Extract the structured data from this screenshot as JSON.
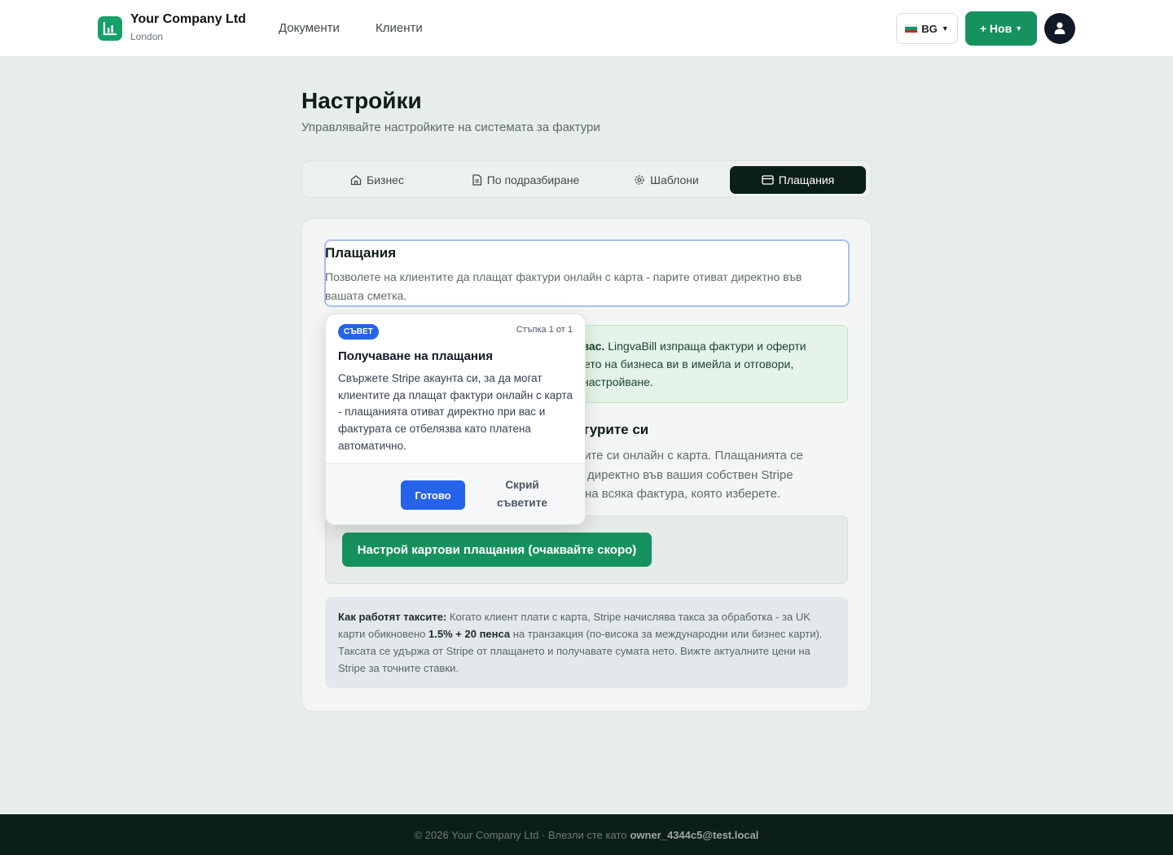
{
  "header": {
    "company_name": "Your Company Ltd",
    "company_city": "London",
    "nav": [
      "Документи",
      "Клиенти"
    ],
    "lang_label": "BG",
    "new_label": "+ Нов",
    "brand_color": "#16925f"
  },
  "page": {
    "title": "Настройки",
    "subtitle": "Управлявайте настройките на системата за фактури"
  },
  "tabs": [
    {
      "label": "Бизнес",
      "icon": "home-icon",
      "active": false
    },
    {
      "label": "По подразбиране",
      "icon": "document-icon",
      "active": false
    },
    {
      "label": "Шаблони",
      "icon": "gear-icon",
      "active": false
    },
    {
      "label": "Плащания",
      "icon": "credit-card-icon",
      "active": true
    }
  ],
  "payments": {
    "title": "Плащания",
    "description": "Позволете на клиентите да плащат фактури онлайн с карта - парите отиват директно във вашата сметка.",
    "green_bold": "о вас.",
    "green_text_1": "LingvaBill изпраща фактури и оферти",
    "green_text_2": "ето на бизнеса ви в имейла и отговори,",
    "green_text_3": "настройване.",
    "sub_title": "турите си",
    "sub_desc_1": "ите си онлайн с карта. Плащанията се",
    "sub_desc_2": "директно във вашия собствен Stripe",
    "sub_desc_3": "на всяка фактура, която изберете.",
    "setup_button": "Настрой картови плащания (очаквайте скоро)",
    "fee_bold": "Как работят таксите:",
    "fee_text_1": "Когато клиент плати с карта, Stripe начислява такса за обработка - за UK карти обикновено",
    "fee_highlight": "1.5% + 20 пенса",
    "fee_text_2": "на транзакция (по-висока за международни или бизнес карти). Таксата се удържа от Stripe от плащането и получавате сумата нето. Вижте актуалните цени на Stripe за точните ставки."
  },
  "tip": {
    "badge": "СЪВЕТ",
    "step": "Стъпка 1 от 1",
    "title": "Получаване на плащания",
    "body": "Свържете Stripe акаунта си, за да могат клиентите да плащат фактури онлайн с карта - плащанията отиват директно при вас и фактурата се отбелязва като платена автоматично.",
    "done_label": "Готово",
    "hide_label": "Скрий съветите",
    "accent_color": "#2563eb"
  },
  "footer": {
    "text": "© 2026 Your Company Ltd · Влезли сте като",
    "user": "owner_4344c5@test.local"
  }
}
